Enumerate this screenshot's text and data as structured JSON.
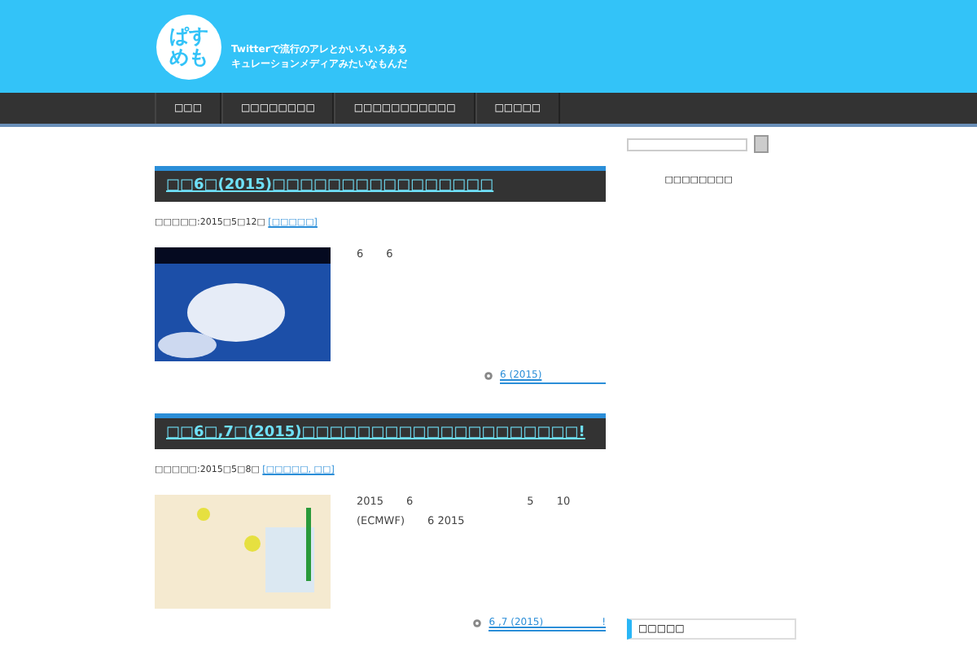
{
  "header": {
    "logo": [
      "ぱす",
      "めも"
    ],
    "tagline": [
      "Twitterで流行のアレとかいろいろある",
      "キュレーションメディアみたいなもんだ"
    ]
  },
  "nav": [
    {
      "label": "□□□"
    },
    {
      "label": "□□□□□□□□"
    },
    {
      "label": "□□□□□□□□□□□"
    },
    {
      "label": "□□□□□"
    }
  ],
  "posts": [
    {
      "title": "□□6□(2015)□□□□□□□□□□□□□□□□",
      "meta": "□□□□□:2015□5□12□",
      "categories": "[□□□□□]",
      "excerpt": [
        "6　　6"
      ],
      "more": "6 (2015)"
    },
    {
      "title": "□□6□,7□(2015)□□□□□□□□□□□□□□□□□□□□!",
      "meta": "□□□□□:2015□5□8□",
      "categories": "[□□□□□, □□]",
      "excerpt": [
        "2015　　6　　　　　　　　　　5　　10",
        "(ECMWF)　　6 2015"
      ],
      "more": "6 ,7 (2015)　　　　　　!"
    }
  ],
  "sidebar": {
    "heading": "□□□□□□□□",
    "widget": "□□□□□"
  }
}
